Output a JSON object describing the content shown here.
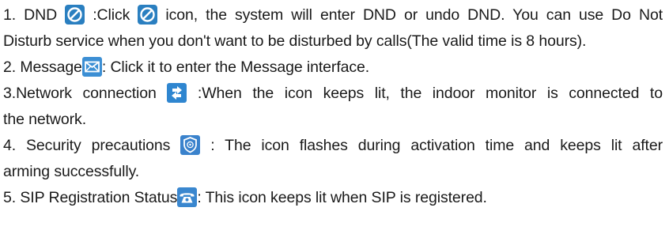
{
  "items": [
    {
      "lead": "1. DND",
      "mid": ":Click",
      "trail1": "icon, the system will enter DND or undo DND. You can use Do Not",
      "trail2": "Disturb service when you don't want to be disturbed by calls(The valid time is 8 hours).",
      "icon": "dnd-icon"
    },
    {
      "lead": "2. Message",
      "trail1": ": Click it to enter the Message interface.",
      "icon": "message-icon"
    },
    {
      "lead": "3.Network connection",
      "trail1": ":When the icon keeps lit, the indoor monitor is connected to",
      "trail2": "the network.",
      "icon": "network-icon"
    },
    {
      "lead": "4. Security precautions",
      "trail1": ":  The icon flashes during activation time and keeps lit after",
      "trail2": "arming successfully.",
      "icon": "security-icon"
    },
    {
      "lead": "5. SIP Registration Status",
      "trail1": ": This icon keeps lit when SIP is registered.",
      "icon": "sip-phone-icon"
    }
  ],
  "colors": {
    "icon_blue": "#2f86d0",
    "text": "#1a1a1a"
  }
}
